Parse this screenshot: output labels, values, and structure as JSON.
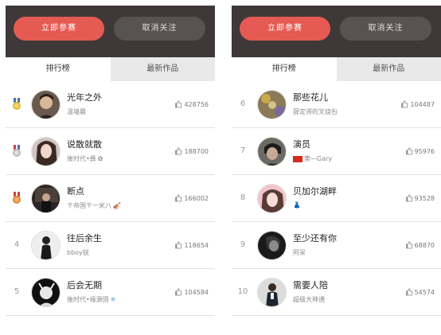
{
  "colors": {
    "accent": "#e55a52",
    "topbar": "#3e3838",
    "cancel": "#5a5252"
  },
  "left_panel": {
    "join_label": "立即参赛",
    "cancel_label": "取消关注",
    "tabs": [
      "排行榜",
      "最新作品"
    ],
    "rows": [
      {
        "rank": "",
        "medal": "gold",
        "title": "光年之外",
        "sub": "温墙晨",
        "score": "428756"
      },
      {
        "rank": "",
        "medal": "silver",
        "title": "说散就散",
        "sub": "後时代•彝",
        "score": "188700"
      },
      {
        "rank": "",
        "medal": "bronze",
        "title": "断点",
        "sub": "〒帝国〒一米八",
        "score": "166002"
      },
      {
        "rank": "4",
        "medal": "",
        "title": "往后余生",
        "sub": "bboy锐",
        "score": "118654"
      },
      {
        "rank": "5",
        "medal": "",
        "title": "后会无期",
        "sub": "後时代•缘源固",
        "score": "104584"
      }
    ]
  },
  "right_panel": {
    "join_label": "立即参赛",
    "cancel_label": "取消关注",
    "tabs": [
      "排行榜",
      "最新作品"
    ],
    "rows": [
      {
        "rank": "6",
        "title": "那些花儿",
        "sub": "薛定谔的叉烧包",
        "score": "104487"
      },
      {
        "rank": "7",
        "title": "演员",
        "sub": "樂—Gary",
        "score": "95976"
      },
      {
        "rank": "8",
        "title": "贝加尔湖畔",
        "sub": "",
        "score": "93528"
      },
      {
        "rank": "9",
        "title": "至少还有你",
        "sub": "阿呆",
        "score": "68870"
      },
      {
        "rank": "10",
        "title": "需要人陪",
        "sub": "超级大神通",
        "score": "54574"
      }
    ]
  }
}
